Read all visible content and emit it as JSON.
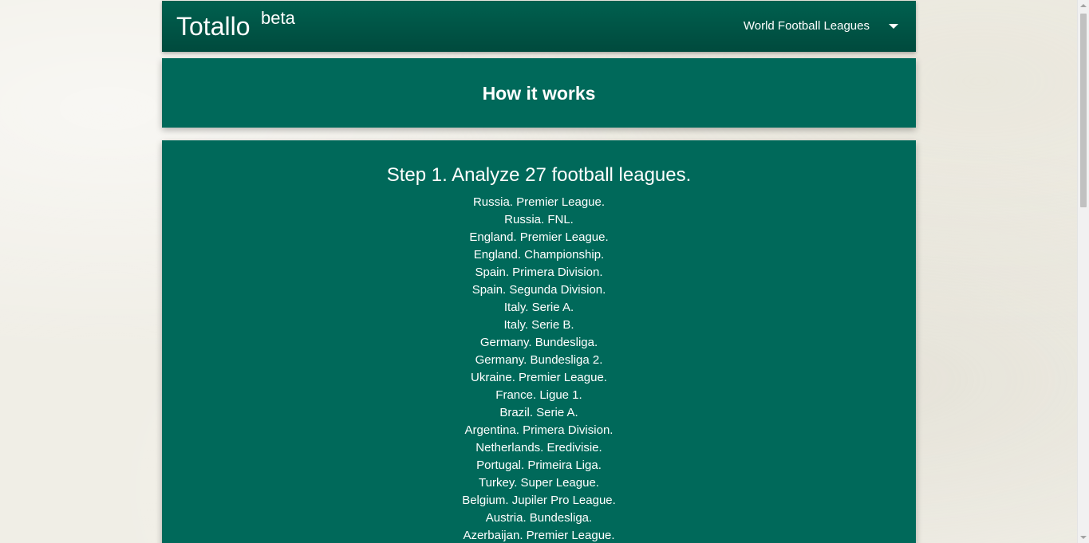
{
  "header": {
    "brand": "Totallo",
    "brand_sup": "beta",
    "league_select_label": "World Football Leagues",
    "league_select_icon": "caret-down-icon"
  },
  "how_it_works": {
    "title": "How it works"
  },
  "step1": {
    "title": "Step 1. Analyze 27 football leagues.",
    "leagues": [
      "Russia. Premier League.",
      "Russia. FNL.",
      "England. Premier League.",
      "England. Championship.",
      "Spain. Primera Division.",
      "Spain. Segunda Division.",
      "Italy. Serie A.",
      "Italy. Serie B.",
      "Germany. Bundesliga.",
      "Germany. Bundesliga 2.",
      "Ukraine. Premier League.",
      "France. Ligue 1.",
      "Brazil. Serie A.",
      "Argentina. Primera Division.",
      "Netherlands. Eredivisie.",
      "Portugal. Primeira Liga.",
      "Turkey. Super League.",
      "Belgium. Jupiler Pro League.",
      "Austria. Bundesliga.",
      "Azerbaijan. Premier League."
    ]
  },
  "colors": {
    "header_bg": "#004a3d",
    "card_bg": "#00695a",
    "page_bg": "#f0eee6",
    "text": "#ffffff"
  }
}
